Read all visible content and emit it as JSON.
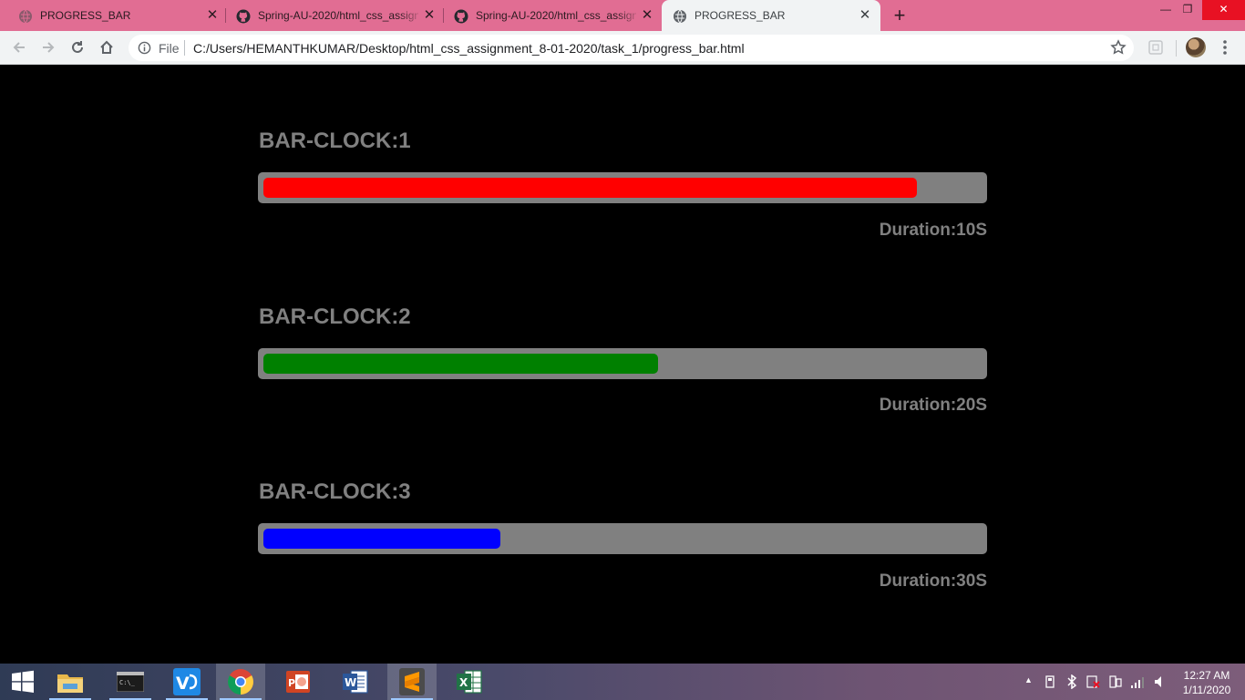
{
  "browser": {
    "tabs": [
      {
        "title": "PROGRESS_BAR",
        "favicon": "globe-icon",
        "active": false
      },
      {
        "title": "Spring-AU-2020/html_css_assign",
        "favicon": "github-icon",
        "active": false
      },
      {
        "title": "Spring-AU-2020/html_css_assign",
        "favicon": "github-icon",
        "active": false
      },
      {
        "title": "PROGRESS_BAR",
        "favicon": "globe-icon",
        "active": true
      }
    ],
    "address_scheme_label": "File",
    "address_url": "C:/Users/HEMANTHKUMAR/Desktop/html_css_assignment_8-01-2020/task_1/progress_bar.html",
    "tab_strip_color": "#e16d93"
  },
  "page": {
    "background": "#000000",
    "clocks": [
      {
        "title": "BAR-CLOCK:1",
        "duration": "Duration:10S",
        "fill_color": "#ff0000",
        "progress_fraction": 0.91
      },
      {
        "title": "BAR-CLOCK:2",
        "duration": "Duration:20S",
        "fill_color": "#008000",
        "progress_fraction": 0.55
      },
      {
        "title": "BAR-CLOCK:3",
        "duration": "Duration:30S",
        "fill_color": "#0000ff",
        "progress_fraction": 0.33
      }
    ],
    "track_color": "#808080",
    "text_color": "#808080"
  },
  "taskbar": {
    "apps": [
      "windows-start-icon",
      "file-explorer-icon",
      "terminal-icon",
      "vs-code-icon",
      "chrome-icon",
      "powerpoint-icon",
      "word-icon",
      "sublime-text-icon",
      "excel-icon"
    ],
    "time": "12:27 AM",
    "date": "1/11/2020"
  }
}
